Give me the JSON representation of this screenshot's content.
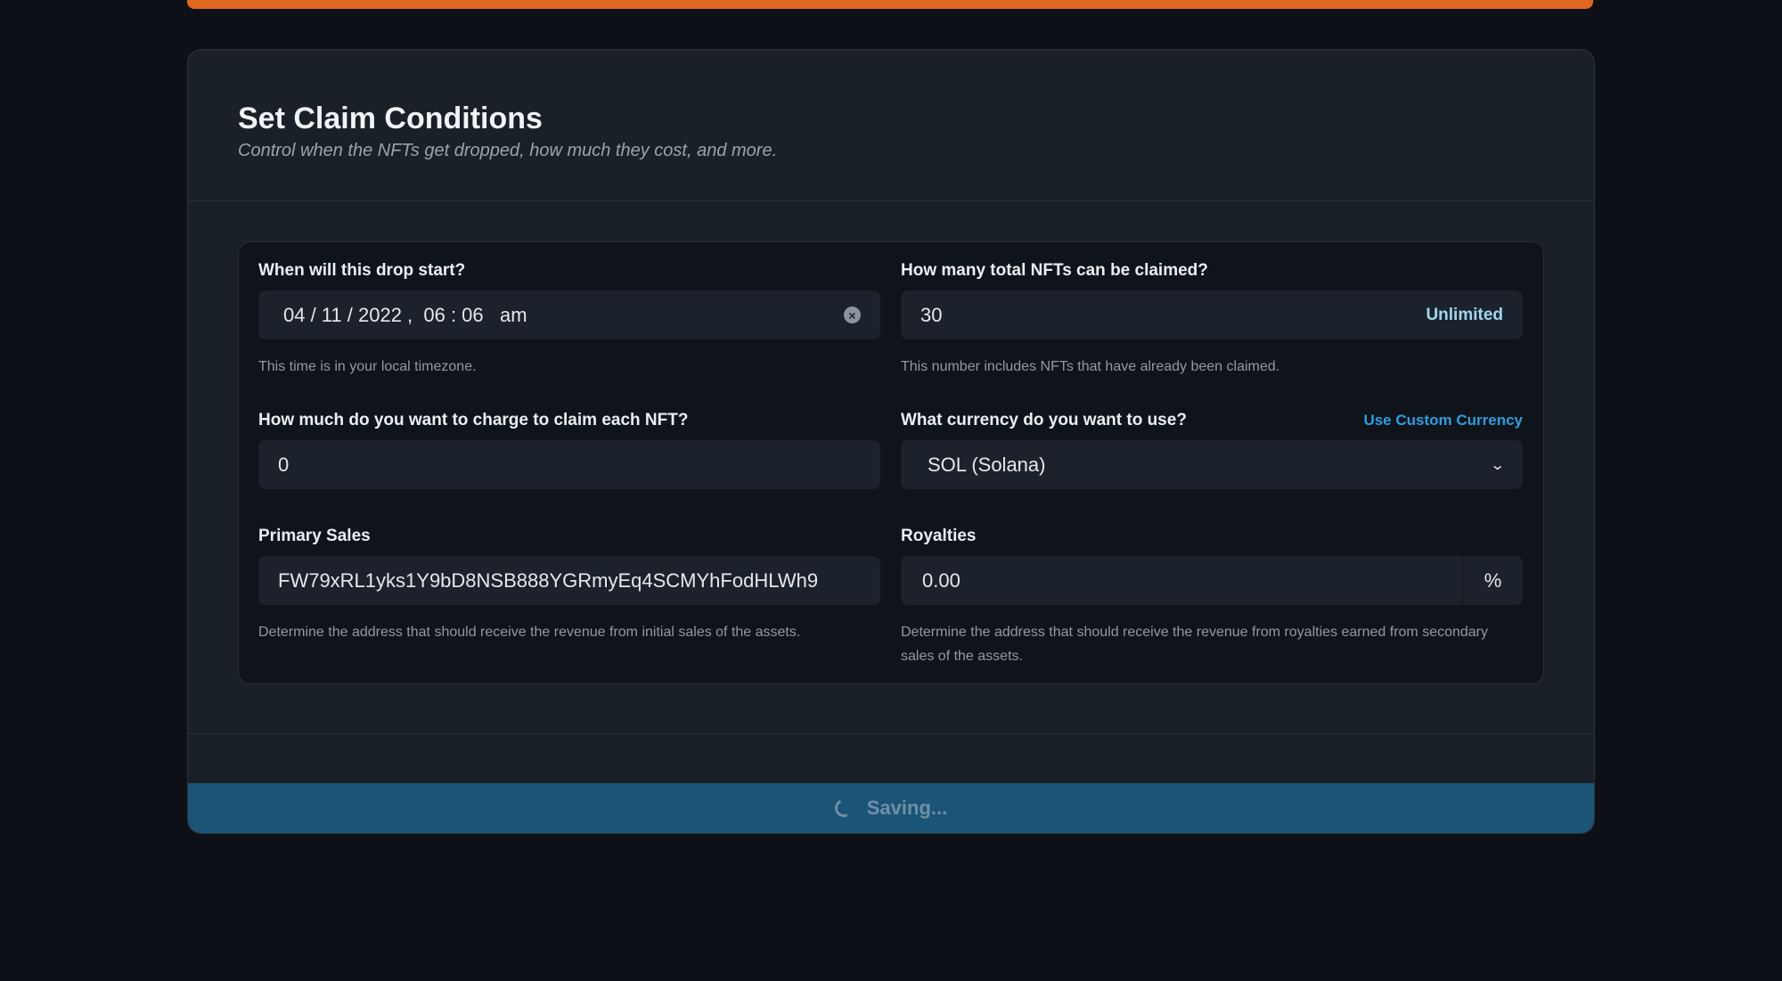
{
  "page": {
    "accent_color": "#e0671f",
    "title": "Set Claim Conditions",
    "subtitle": "Control when the NFTs get dropped, how much they cost, and more."
  },
  "form": {
    "start": {
      "label": "When will this drop start?",
      "value": "04 / 11 / 2022 ,  06 : 06   am",
      "clear_icon": "x-circle-icon",
      "helper": "This time is in your local timezone."
    },
    "quantity": {
      "label": "How many total NFTs can be claimed?",
      "value": "30",
      "unlimited_label": "Unlimited",
      "helper": "This number includes NFTs that have already been claimed."
    },
    "price": {
      "label": "How much do you want to charge to claim each NFT?",
      "value": "0"
    },
    "currency": {
      "label": "What currency do you want to use?",
      "custom_link": "Use Custom Currency",
      "selected": "SOL (Solana)",
      "chevron_icon": "chevron-down-icon"
    },
    "primary_sales": {
      "label": "Primary Sales",
      "value": "FW79xRL1yks1Y9bD8NSB888YGRmyEq4SCMYhFodHLWh9",
      "helper": "Determine the address that should receive the revenue from initial sales of the assets."
    },
    "royalties": {
      "label": "Royalties",
      "value": "0.00",
      "unit": "%",
      "helper": "Determine the address that should receive the revenue from royalties earned from secondary sales of the assets."
    }
  },
  "save_button": {
    "label": "Saving...",
    "icon": "spinner-icon",
    "color": "#1a5577"
  }
}
